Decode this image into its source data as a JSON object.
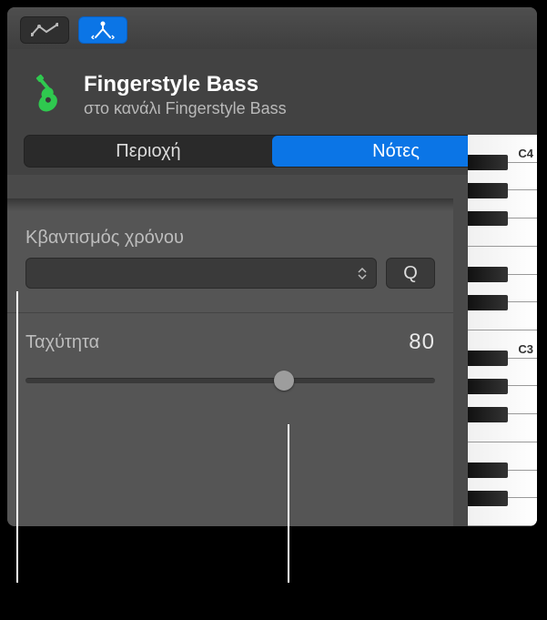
{
  "toolbar": {
    "automation_tool": "automation-curve",
    "flex_tool": "flex"
  },
  "header": {
    "title": "Fingerstyle Bass",
    "subtitle": "στο κανάλι Fingerstyle Bass"
  },
  "segmented": {
    "items": [
      {
        "label": "Περιοχή",
        "selected": false
      },
      {
        "label": "Νότες",
        "selected": true
      }
    ]
  },
  "quantize": {
    "label": "Κβαντισμός χρόνου",
    "value": "",
    "q_button": "Q"
  },
  "velocity": {
    "label": "Ταχύτητα",
    "value": "80",
    "min": 0,
    "max": 127
  },
  "piano": {
    "labels": [
      "C4",
      "C3"
    ]
  }
}
